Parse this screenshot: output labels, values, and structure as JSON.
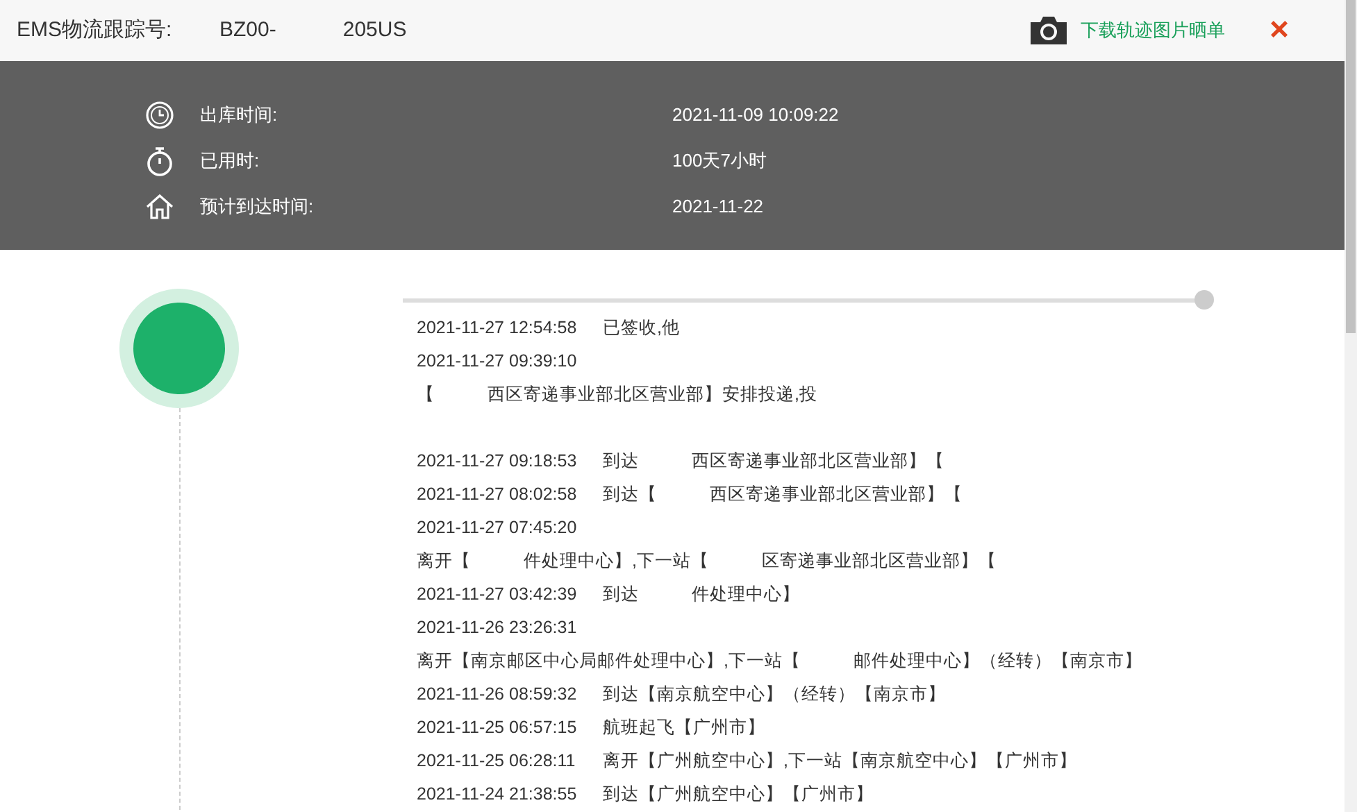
{
  "header": {
    "label": "EMS物流跟踪号:",
    "tracking_parts": [
      "BZ00-",
      "205US"
    ],
    "download_link": "下载轨迹图片晒单",
    "close": "×"
  },
  "summary": [
    {
      "kind": "clock",
      "label": "出库时间:",
      "value": "2021-11-09 10:09:22"
    },
    {
      "kind": "stopwatch",
      "label": "已用时:",
      "value": "100天7小时"
    },
    {
      "kind": "home",
      "label": "预计到达时间:",
      "value": "2021-11-22"
    }
  ],
  "events": [
    {
      "kind": "entry",
      "time": "2021-11-27 12:54:58",
      "parts": [
        "已签收,他"
      ]
    },
    {
      "kind": "time",
      "time": "2021-11-27 09:39:10"
    },
    {
      "kind": "text",
      "parts": [
        "【",
        "西区寄递事业部北区营业部】安排投递,投"
      ]
    },
    {
      "kind": "blank"
    },
    {
      "kind": "entry",
      "time": "2021-11-27 09:18:53",
      "parts": [
        "到达",
        "西区寄递事业部北区营业部】【"
      ]
    },
    {
      "kind": "entry",
      "time": "2021-11-27 08:02:58",
      "parts": [
        "到达【",
        "西区寄递事业部北区营业部】【"
      ]
    },
    {
      "kind": "time",
      "time": "2021-11-27 07:45:20"
    },
    {
      "kind": "text",
      "parts": [
        "离开【",
        "件处理中心】,下一站【",
        "区寄递事业部北区营业部】【"
      ]
    },
    {
      "kind": "entry",
      "time": "2021-11-27 03:42:39",
      "parts": [
        "到达",
        "件处理中心】"
      ]
    },
    {
      "kind": "time",
      "time": "2021-11-26 23:26:31"
    },
    {
      "kind": "text",
      "parts": [
        "离开【南京邮区中心局邮件处理中心】,下一站【",
        "邮件处理中心】（经转）【南京市】"
      ]
    },
    {
      "kind": "entry",
      "time": "2021-11-26 08:59:32",
      "parts": [
        "到达【南京航空中心】（经转）【南京市】"
      ]
    },
    {
      "kind": "entry",
      "time": "2021-11-25 06:57:15",
      "parts": [
        "航班起飞【广州市】"
      ]
    },
    {
      "kind": "entry",
      "time": "2021-11-25 06:28:11",
      "parts": [
        "离开【广州航空中心】,下一站【南京航空中心】【广州市】"
      ]
    },
    {
      "kind": "entry",
      "time": "2021-11-24 21:38:55",
      "parts": [
        "到达【广州航空中心】【广州市】"
      ]
    }
  ]
}
